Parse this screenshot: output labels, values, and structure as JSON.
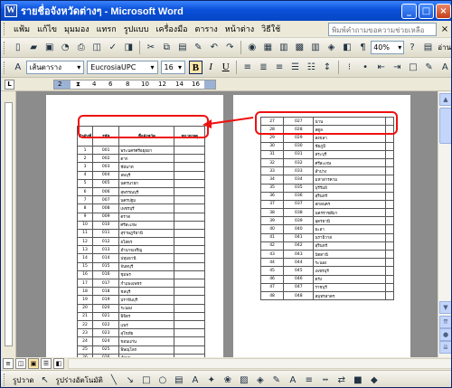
{
  "window": {
    "title": "รายชื่อจังหวัดต่างๆ - Microsoft Word"
  },
  "menu": {
    "items": [
      "แฟ้ม",
      "แก้ไข",
      "มุมมอง",
      "แทรก",
      "รูปแบบ",
      "เครื่องมือ",
      "ตาราง",
      "หน้าต่าง",
      "วิธีใช้"
    ],
    "help_placeholder": "พิมพ์คำถามขอความช่วยเหลือ"
  },
  "toolbar": {
    "zoom": "40%",
    "read_label": "อ่าน",
    "style": "เส้นตาราง",
    "font": "EucrosiaUPC",
    "size": "16"
  },
  "ruler": {
    "ticks": [
      "2",
      "4",
      "6",
      "8",
      "10",
      "12",
      "14",
      "16"
    ]
  },
  "drawbar": {
    "draw_label": "รูปวาด",
    "autoshapes_label": "รูปร่างอัตโนมัติ"
  },
  "page1": {
    "headers": [
      "ลำดับที่",
      "รหัส",
      "ชื่อจังหวัด",
      "หมายเหตุ"
    ],
    "rows": [
      [
        "1",
        "001",
        "พระนครศรีอยุธยา"
      ],
      [
        "2",
        "002",
        "ตาก"
      ],
      [
        "3",
        "003",
        "ชัยนาท"
      ],
      [
        "4",
        "004",
        "ลพบุรี"
      ],
      [
        "5",
        "005",
        "นครนายก"
      ],
      [
        "6",
        "006",
        "สุพรรณบุรี"
      ],
      [
        "7",
        "007",
        "นครปฐม"
      ],
      [
        "8",
        "008",
        "เพชรบุรี"
      ],
      [
        "9",
        "009",
        "ตราด"
      ],
      [
        "10",
        "010",
        "ศรีสะเกษ"
      ],
      [
        "11",
        "011",
        "สุราษฎร์ธานี"
      ],
      [
        "12",
        "012",
        "ยโสธร"
      ],
      [
        "13",
        "013",
        "อำนาจเจริญ"
      ],
      [
        "14",
        "014",
        "ปทุมธานี"
      ],
      [
        "15",
        "015",
        "จันทบุรี"
      ],
      [
        "16",
        "016",
        "ชุมพร"
      ],
      [
        "17",
        "017",
        "กำแพงเพชร"
      ],
      [
        "18",
        "018",
        "ชลบุรี"
      ],
      [
        "19",
        "019",
        "ปราจีนบุรี"
      ],
      [
        "20",
        "020",
        "ระนอง"
      ],
      [
        "21",
        "021",
        "พิจิตร"
      ],
      [
        "22",
        "022",
        "แพร่"
      ],
      [
        "23",
        "023",
        "สุโขทัย"
      ],
      [
        "24",
        "024",
        "ขอนแก่น"
      ],
      [
        "25",
        "025",
        "พิษณุโลก"
      ],
      [
        "26",
        "026",
        "ลำพูน"
      ]
    ]
  },
  "page2": {
    "rows": [
      [
        "27",
        "027",
        "น่าน"
      ],
      [
        "28",
        "028",
        "สตูล"
      ],
      [
        "29",
        "029",
        "สงขลา"
      ],
      [
        "30",
        "030",
        "ชัยภูมิ"
      ],
      [
        "31",
        "031",
        "สระบุรี"
      ],
      [
        "32",
        "032",
        "ศรีสะเกษ"
      ],
      [
        "33",
        "033",
        "ลำปาง"
      ],
      [
        "34",
        "034",
        "มหาสารคาม"
      ],
      [
        "35",
        "035",
        "บุรีรัมย์"
      ],
      [
        "36",
        "036",
        "สุรินทร์"
      ],
      [
        "37",
        "037",
        "สกลนคร"
      ],
      [
        "38",
        "038",
        "นครราชสีมา"
      ],
      [
        "39",
        "039",
        "อุดรธานี"
      ],
      [
        "40",
        "040",
        "ยะลา"
      ],
      [
        "41",
        "041",
        "นราธิวาส"
      ],
      [
        "42",
        "042",
        "สุรินทร์"
      ],
      [
        "43",
        "043",
        "ปัตตานี"
      ],
      [
        "44",
        "044",
        "ระนอง"
      ],
      [
        "45",
        "045",
        "เพชรบุรี"
      ],
      [
        "46",
        "046",
        "ตรัง"
      ],
      [
        "47",
        "047",
        "ราชบุรี"
      ],
      [
        "48",
        "048",
        "สมุทรสาคร"
      ]
    ]
  }
}
